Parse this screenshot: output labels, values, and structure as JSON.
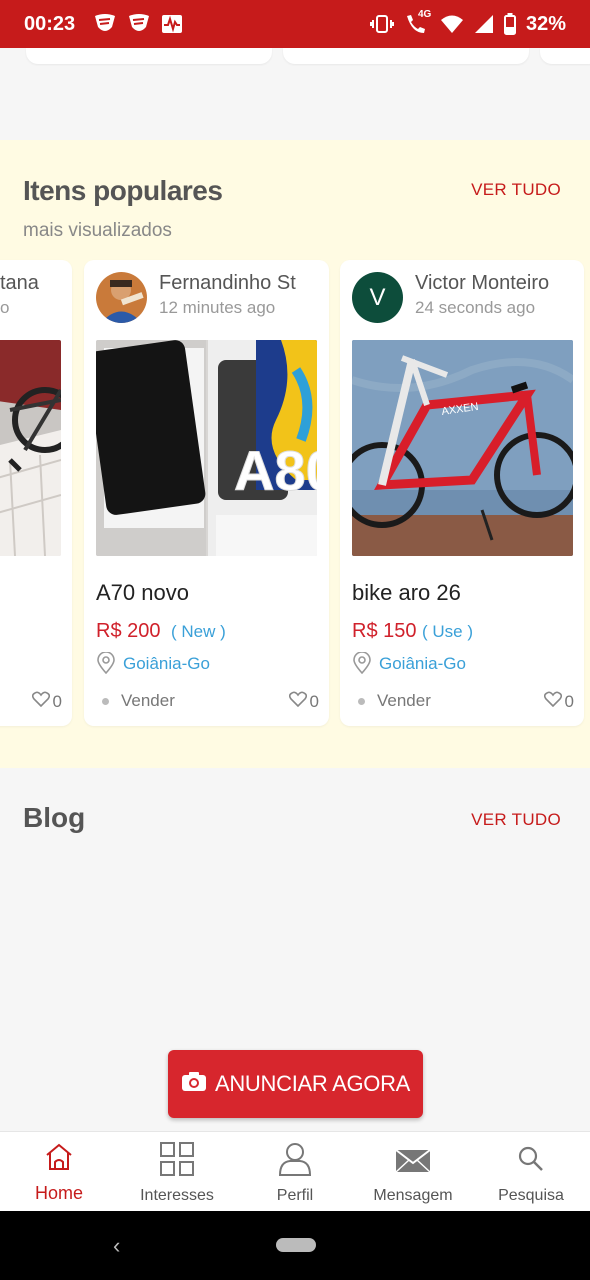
{
  "status_bar": {
    "time": "00:23",
    "battery": "32%",
    "network": "4G"
  },
  "popular": {
    "title": "Itens populares",
    "subtitle": "mais visualizados",
    "see_all": "VER TUDO",
    "cards": [
      {
        "user": "tana",
        "time": "o",
        "title": "",
        "price": "",
        "condition": "",
        "location": "",
        "sale_type": "",
        "likes": "0"
      },
      {
        "user": "Fernandinho St",
        "time": "12 minutes ago",
        "title": "A70 novo",
        "price": "R$ 200",
        "condition": "( New )",
        "location": "Goiânia-Go",
        "sale_type": "Vender",
        "likes": "0"
      },
      {
        "user": "Victor Monteiro",
        "avatar_letter": "V",
        "time": "24 seconds ago",
        "title": "bike aro 26",
        "price": "R$ 150",
        "condition": "( Use )",
        "location": "Goiânia-Go",
        "sale_type": "Vender",
        "likes": "0"
      }
    ]
  },
  "blog": {
    "title": "Blog",
    "see_all": "VER TUDO"
  },
  "cta": {
    "label": "ANUNCIAR AGORA"
  },
  "bottom_nav": {
    "items": [
      {
        "label": "Home",
        "icon": "home-icon",
        "active": true
      },
      {
        "label": "Interesses",
        "icon": "grid-icon"
      },
      {
        "label": "Perfil",
        "icon": "user-icon"
      },
      {
        "label": "Mensagem",
        "icon": "mail-icon"
      },
      {
        "label": "Pesquisa",
        "icon": "search-icon"
      }
    ]
  },
  "colors": {
    "brand_red": "#c61b1b",
    "accent_red": "#d7262d",
    "link_blue": "#3aa0d8",
    "section_bg": "#fffbe3",
    "avatar_green": "#0d4d3b"
  }
}
